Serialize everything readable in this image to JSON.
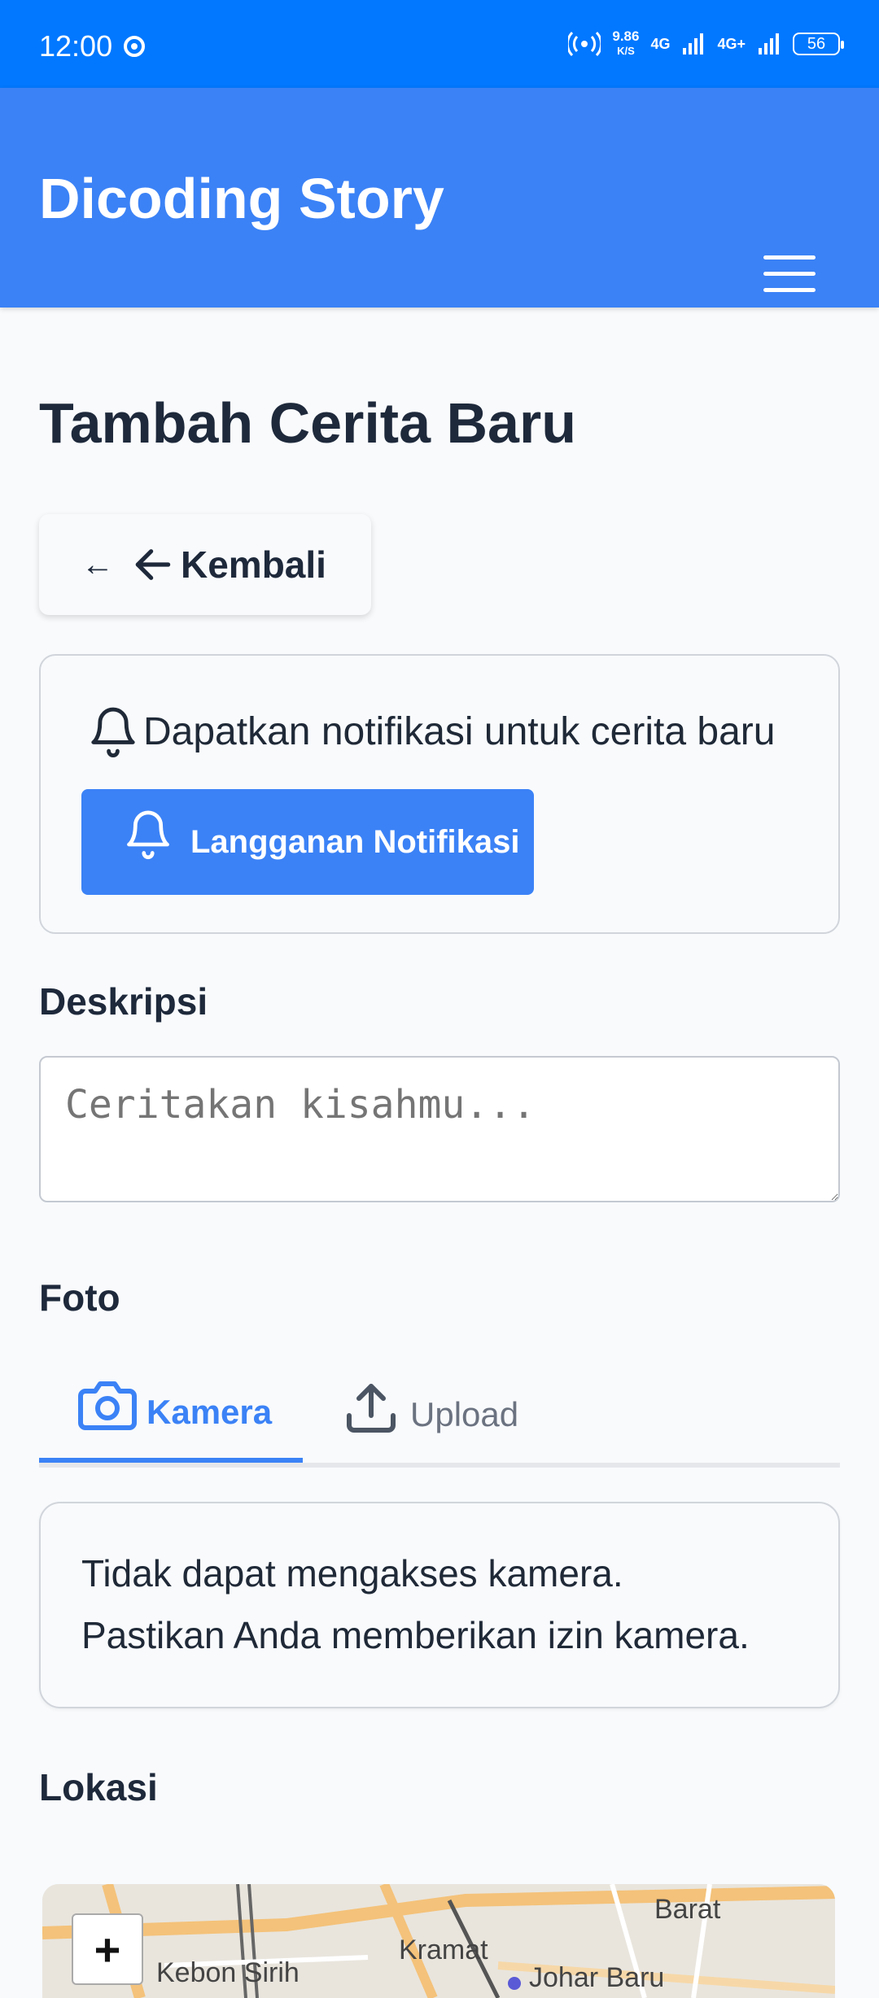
{
  "status_bar": {
    "time": "12:00",
    "net_speed": "9.86",
    "net_unit": "K/S",
    "sim1": "4G",
    "sim2": "4G+",
    "battery": "56"
  },
  "app": {
    "title": "Dicoding Story",
    "menu_icon": "hamburger-menu-icon"
  },
  "page": {
    "title": "Tambah Cerita Baru",
    "back_arrow_text": "←",
    "back_label": "Kembali"
  },
  "notification": {
    "text": "Dapatkan notifikasi untuk cerita baru",
    "button_label": "Langganan Notifikasi"
  },
  "form": {
    "description_label": "Deskripsi",
    "description_placeholder": "Ceritakan kisahmu...",
    "photo_label": "Foto",
    "tabs": [
      {
        "label": "Kamera",
        "active": true,
        "icon": "camera-icon"
      },
      {
        "label": "Upload",
        "active": false,
        "icon": "upload-icon"
      }
    ],
    "camera_error_line1": "Tidak dapat mengakses kamera.",
    "camera_error_line2": "Pastikan Anda memberikan izin kamera.",
    "location_label": "Lokasi"
  },
  "map": {
    "zoom_in": "+",
    "labels": [
      "Barat",
      "Kebon Sirih",
      "Kramat",
      "Johar Baru"
    ]
  },
  "colors": {
    "status_bar": "#0178ff",
    "primary": "#3b82f6",
    "text_dark": "#1e293b"
  }
}
